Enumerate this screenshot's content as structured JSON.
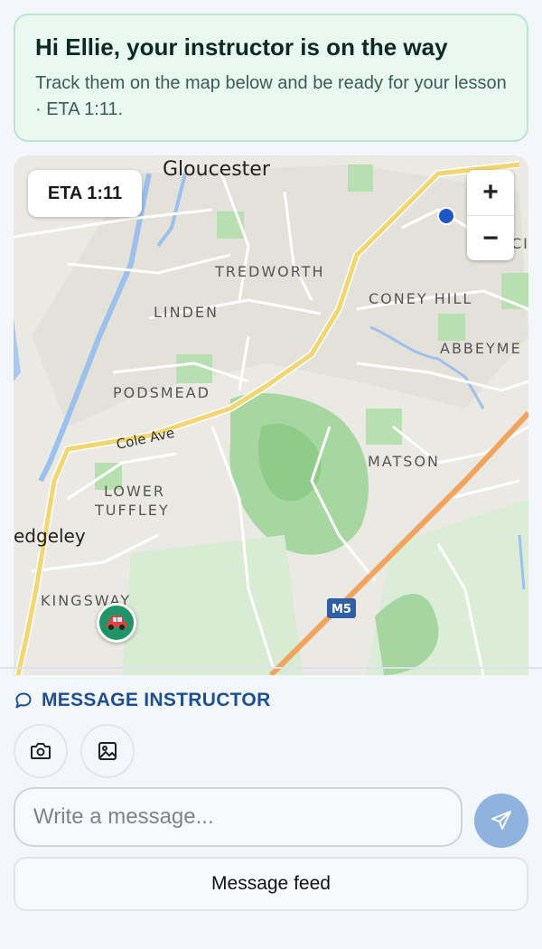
{
  "banner": {
    "title": "Hi Ellie, your instructor is on the way",
    "subtitle": "Track them on the map below and be ready for your lesson · ETA 1:11."
  },
  "map": {
    "eta_chip": "ETA 1:11",
    "zoom_in": "+",
    "zoom_out": "−",
    "place_labels": {
      "gloucester": "Gloucester",
      "tredworth": "TREDWORTH",
      "linden": "LINDEN",
      "coney_hill": "CONEY HILL",
      "abbeymead": "ABBEYME",
      "podsmead": "PODSMEAD",
      "cole_ave": "Cole Ave",
      "matson": "MATSON",
      "lower": "LOWER",
      "tuffley": "TUFFLEY",
      "quedgeley": "edgeley",
      "kingsway": "KINGSWAY",
      "m5": "M5",
      "edge_ci": "CI"
    },
    "instructor_marker_icon": "car-icon",
    "student_marker_color": "#1f56c5"
  },
  "messaging": {
    "heading": "MESSAGE INSTRUCTOR",
    "camera_icon": "camera-icon",
    "gallery_icon": "image-icon",
    "input_placeholder": "Write a message...",
    "send_icon": "send-icon",
    "feed_button": "Message feed"
  },
  "colors": {
    "accent": "#1d4f91",
    "banner_bg": "#e9f8f1",
    "banner_border": "#b9e6cf",
    "send_bg": "#8fb3de",
    "car_marker": "#1e9468"
  }
}
